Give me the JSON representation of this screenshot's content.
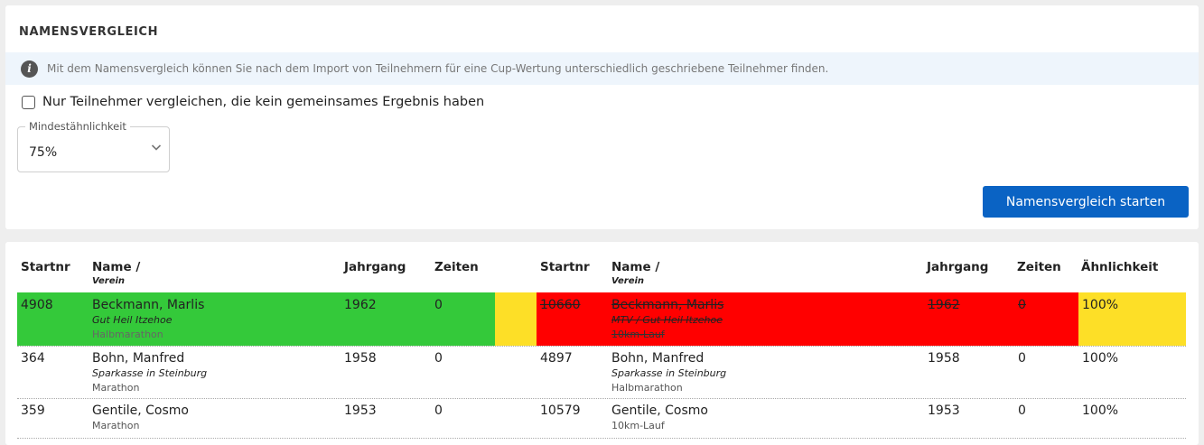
{
  "settings": {
    "title": "NAMENSVERGLEICH",
    "info_text": "Mit dem Namensvergleich können Sie nach dem Import von Teilnehmern für eine Cup-Wertung unterschiedlich geschriebene Teilnehmer finden.",
    "checkbox_label": "Nur Teilnehmer vergleichen, die kein gemeinsames Ergebnis haben",
    "checkbox_checked": false,
    "similarity_label": "Mindestähnlichkeit",
    "similarity_value": "75%",
    "start_button": "Namensvergleich starten"
  },
  "table": {
    "headers": {
      "startnr_a": "Startnr",
      "name_a": "Name /",
      "verein_a": "Verein",
      "jahrgang_a": "Jahrgang",
      "zeiten_a": "Zeiten",
      "startnr_b": "Startnr",
      "name_b": "Name /",
      "verein_b": "Verein",
      "jahrgang_b": "Jahrgang",
      "zeiten_b": "Zeiten",
      "aehnlichkeit": "Ähnlichkeit"
    },
    "rows": [
      {
        "a": {
          "startnr": "4908",
          "name": "Beckmann, Marlis",
          "verein": "Gut Heil Itzehoe",
          "wettbewerb": "Halbmarathon",
          "jahrgang": "1962",
          "zeiten": "0"
        },
        "b": {
          "startnr": "10660",
          "name": "Beckmann, Marlis",
          "verein": "MTV / Gut Heil Itzehoe",
          "wettbewerb": "10km-Lauf",
          "jahrgang": "1962",
          "zeiten": "0"
        },
        "aehnlichkeit": "100%"
      },
      {
        "a": {
          "startnr": "364",
          "name": "Bohn, Manfred",
          "verein": "Sparkasse in Steinburg",
          "wettbewerb": "Marathon",
          "jahrgang": "1958",
          "zeiten": "0"
        },
        "b": {
          "startnr": "4897",
          "name": "Bohn, Manfred",
          "verein": "Sparkasse in Steinburg",
          "wettbewerb": "Halbmarathon",
          "jahrgang": "1958",
          "zeiten": "0"
        },
        "aehnlichkeit": "100%"
      },
      {
        "a": {
          "startnr": "359",
          "name": "Gentile, Cosmo",
          "verein": "",
          "wettbewerb": "Marathon",
          "jahrgang": "1953",
          "zeiten": "0"
        },
        "b": {
          "startnr": "10579",
          "name": "Gentile, Cosmo",
          "verein": "",
          "wettbewerb": "10km-Lauf",
          "jahrgang": "1953",
          "zeiten": "0"
        },
        "aehnlichkeit": "100%"
      }
    ]
  },
  "colors": {
    "keep": "#34c93a",
    "discard": "#ff0000",
    "highlight": "#fddf27",
    "primary_button": "#0a63c4",
    "info_background": "#eef5fc"
  },
  "icons": {
    "info": "info-icon",
    "select": "chevron-down-icon"
  }
}
